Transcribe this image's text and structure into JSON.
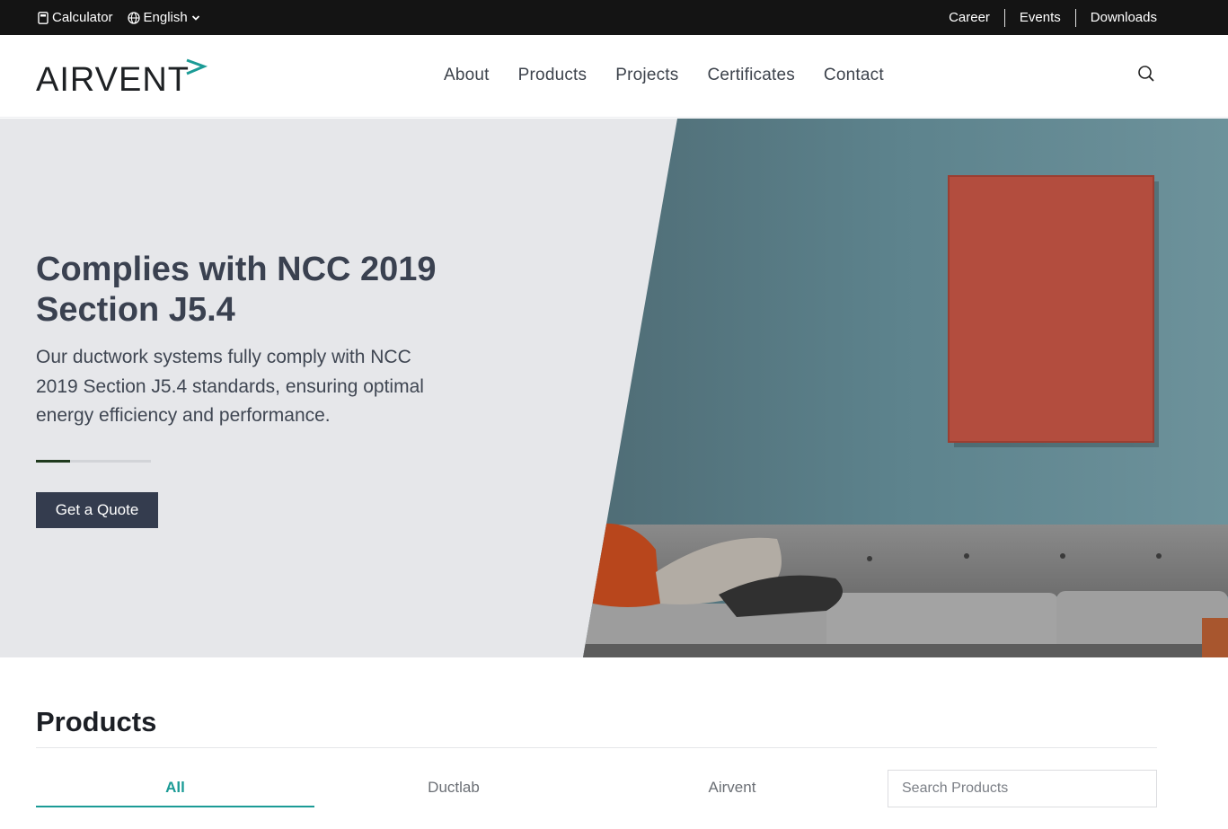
{
  "topbar": {
    "calculator_label": "Calculator",
    "language_label": "English",
    "links": [
      "Career",
      "Events",
      "Downloads"
    ]
  },
  "header": {
    "logo_text": "AIRVENT",
    "nav": [
      "About",
      "Products",
      "Projects",
      "Certificates",
      "Contact"
    ]
  },
  "hero": {
    "title": "Complies with NCC 2019 Section J5.4",
    "description": "Our ductwork systems fully comply with NCC 2019 Section J5.4 standards, ensuring optimal energy efficiency and performance.",
    "slide_progress": 0.3,
    "cta_label": "Get a Quote"
  },
  "products": {
    "title": "Products",
    "tabs": [
      "All",
      "Ductlab",
      "Airvent"
    ],
    "active_tab": "All",
    "search_placeholder": "Search Products"
  },
  "colors": {
    "accent": "#1b9b96",
    "topbar_bg": "#141414",
    "button_bg": "#343c4e",
    "hero_bg": "#e6e7ea"
  }
}
